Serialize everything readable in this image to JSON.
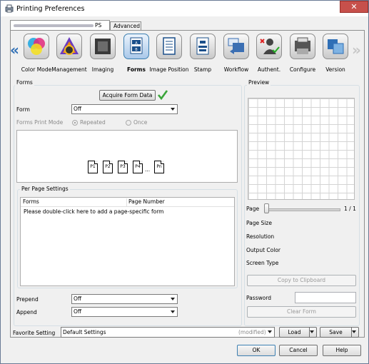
{
  "window": {
    "title": "Printing Preferences",
    "close_label": "✕"
  },
  "tabs": {
    "main_suffix": "PS",
    "advanced": "Advanced"
  },
  "categories": [
    {
      "label": "Color Mode",
      "icon": "color-mode-icon"
    },
    {
      "label": "Management",
      "icon": "management-icon"
    },
    {
      "label": "Imaging",
      "icon": "imaging-icon"
    },
    {
      "label": "Forms",
      "icon": "forms-icon"
    },
    {
      "label": "Image Position",
      "icon": "image-position-icon"
    },
    {
      "label": "Stamp",
      "icon": "stamp-icon"
    },
    {
      "label": "Workflow",
      "icon": "workflow-icon"
    },
    {
      "label": "Authent.",
      "icon": "authentication-icon"
    },
    {
      "label": "Configure",
      "icon": "configure-icon"
    },
    {
      "label": "Version",
      "icon": "version-icon"
    }
  ],
  "nav": {
    "prev": "«",
    "next": "»"
  },
  "forms": {
    "group_title": "Forms",
    "acquire_button": "Acquire Form Data",
    "form_label": "Form",
    "form_value": "Off",
    "print_mode_label": "Forms Print Mode",
    "repeated_label": "Repeated",
    "once_label": "Once",
    "pages": [
      "P1",
      "P2",
      "P3",
      "P4",
      "...",
      "Pn"
    ]
  },
  "per_page": {
    "title": "Per Page Settings",
    "col_forms": "Forms",
    "col_page_number": "Page Number",
    "placeholder_row": "Please double-click here to add a page-specific form"
  },
  "prepend": {
    "label": "Prepend",
    "value": "Off"
  },
  "append": {
    "label": "Append",
    "value": "Off"
  },
  "preview": {
    "title": "Preview",
    "page_label": "Page",
    "page_counter": "1 / 1",
    "page_size_label": "Page Size",
    "resolution_label": "Resolution",
    "output_color_label": "Output Color",
    "screen_type_label": "Screen Type",
    "copy_button": "Copy to Clipboard",
    "password_label": "Password",
    "clear_form_button": "Clear Form"
  },
  "favorite": {
    "label": "Favorite Setting",
    "value": "Default Settings",
    "status": "(modified)",
    "load_button": "Load",
    "save_button": "Save"
  },
  "footer": {
    "ok": "OK",
    "cancel": "Cancel",
    "help": "Help"
  },
  "colors": {
    "accent": "#3c7fb1",
    "check": "#3aa53a",
    "close": "#c7504b"
  }
}
